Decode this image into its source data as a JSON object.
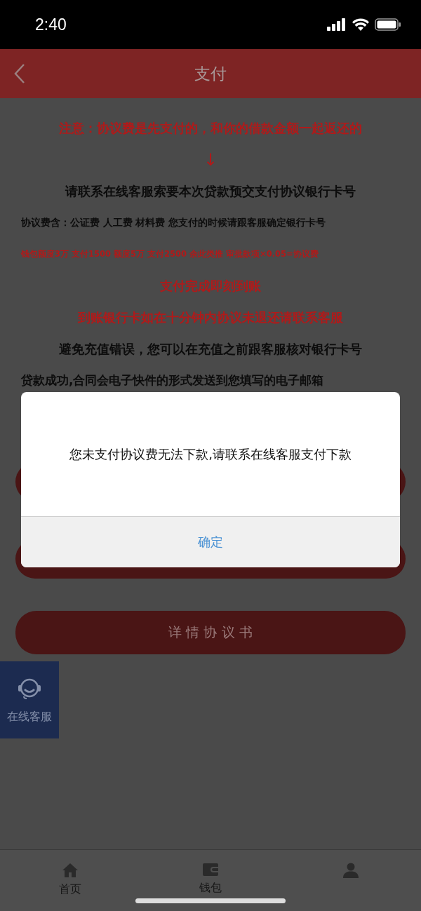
{
  "status_bar": {
    "time": "2:40"
  },
  "header": {
    "title": "支付"
  },
  "notices": [
    {
      "text": "注意：协议费是先支付的，和你的借款金额一起返还的",
      "kind": "alert"
    },
    {
      "text": "↓",
      "kind": "arrow"
    },
    {
      "text": "请联系在线客服索要本次贷款预交支付协议银行卡号",
      "kind": "instruction"
    },
    {
      "text": "协议费含：公证费 人工费 材料费 您支付的时候请跟客服确定银行卡号",
      "kind": "note"
    },
    {
      "text": "钱包额度3万 支付1500  额度5万 支付2500 余此类推 审批款项×0.05=协议费",
      "kind": "formula"
    },
    {
      "text": "支付完成即刻到账",
      "kind": "alert"
    },
    {
      "text": "到账银行卡如在十分钟内协议未退还请联系客服",
      "kind": "alert"
    },
    {
      "text": "避免充值错误，您可以在充值之前跟客服核对银行卡号",
      "kind": "instruction"
    },
    {
      "text": "贷款成功,合同会电子快件的形式发送到您填写的电子邮箱",
      "kind": "footnote"
    }
  ],
  "buttons": [
    {
      "label": "详 情 协 议 书"
    }
  ],
  "service_button": {
    "label": "在线客服"
  },
  "tab_bar": [
    {
      "label": "首页",
      "kind": "home"
    },
    {
      "label": "钱包",
      "kind": "wallet"
    },
    {
      "kind": "profile"
    }
  ],
  "dialog": {
    "message": "您未支付协议费无法下款,请联系在线客服支付下款",
    "confirm": "确定"
  }
}
